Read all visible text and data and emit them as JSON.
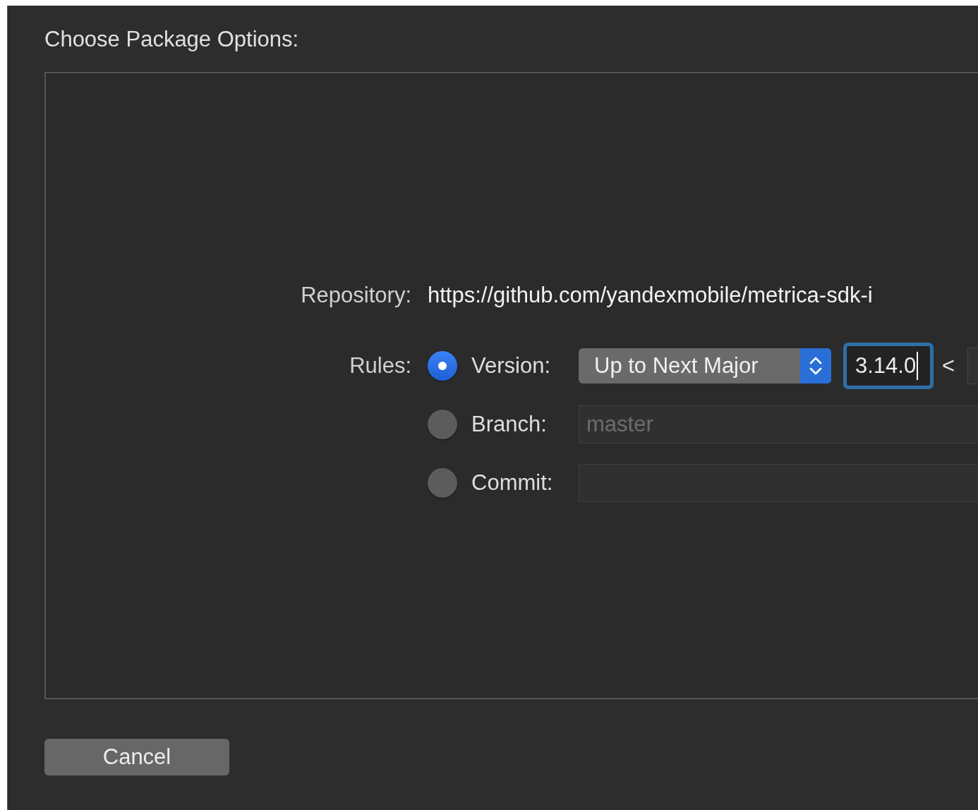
{
  "title": "Choose Package Options:",
  "repository": {
    "label": "Repository:",
    "url": "https://github.com/yandexmobile/metrica-sdk-i"
  },
  "rules": {
    "label": "Rules:",
    "options": [
      {
        "kind": "version",
        "label": "Version:",
        "selected": true,
        "rule": "Up to Next Major",
        "value": "3.14.0",
        "separator": "<"
      },
      {
        "kind": "branch",
        "label": "Branch:",
        "selected": false,
        "placeholder": "master"
      },
      {
        "kind": "commit",
        "label": "Commit:",
        "selected": false
      }
    ]
  },
  "buttons": [
    {
      "label": "Cancel"
    }
  ]
}
